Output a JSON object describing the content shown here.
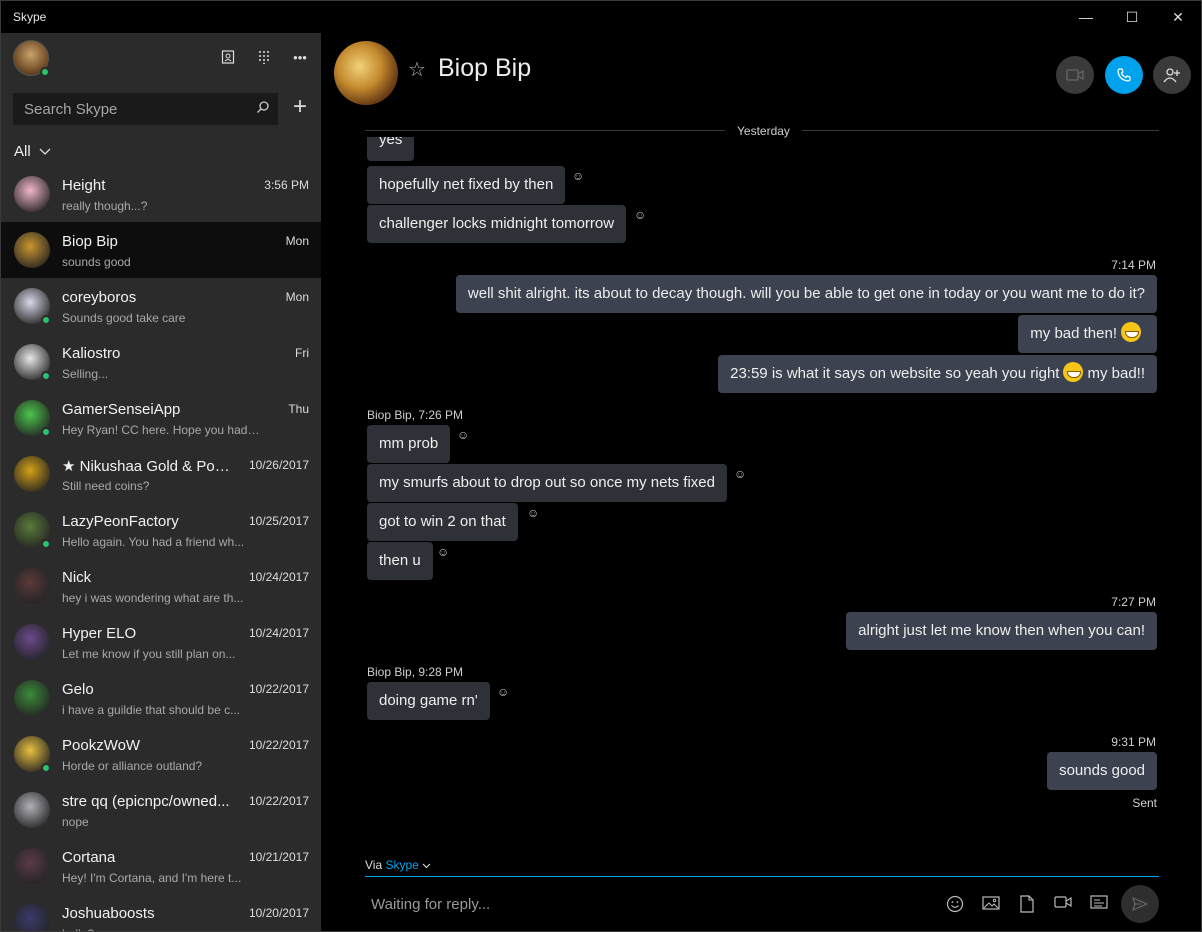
{
  "window": {
    "title": "Skype"
  },
  "sidebar": {
    "search_placeholder": "Search Skype",
    "filter_label": "All",
    "contacts": [
      {
        "name": "Height",
        "preview": "really though...?",
        "time": "3:56 PM",
        "online": false,
        "color": "#f0b6c8"
      },
      {
        "name": "Biop Bip",
        "preview": "sounds good",
        "time": "Mon",
        "online": false,
        "color": "#c9952f"
      },
      {
        "name": "coreyboros",
        "preview": "Sounds good take care",
        "time": "Mon",
        "online": true,
        "color": "#d8d8e8"
      },
      {
        "name": "Kaliostro",
        "preview": "Selling...",
        "time": "Fri",
        "online": true,
        "color": "#e8e8e8"
      },
      {
        "name": "GamerSenseiApp",
        "preview": "Hey Ryan!  CC here. Hope you had a gr...",
        "time": "Thu",
        "online": true,
        "color": "#4cc44c"
      },
      {
        "name": "★ Nikushaa Gold & Pow...",
        "preview": "Still need coins?",
        "time": "10/26/2017",
        "online": false,
        "color": "#d4a017"
      },
      {
        "name": "LazyPeonFactory",
        "preview": "Hello again. You had a friend wh...",
        "time": "10/25/2017",
        "online": true,
        "color": "#5a7a3a"
      },
      {
        "name": "Nick",
        "preview": "hey i was wondering what are th...",
        "time": "10/24/2017",
        "online": false,
        "color": "#5a3a3a"
      },
      {
        "name": "Hyper ELO",
        "preview": "Let me know if you still plan on...",
        "time": "10/24/2017",
        "online": false,
        "color": "#6a4a8a"
      },
      {
        "name": "Gelo",
        "preview": "i have a guildie that should be c...",
        "time": "10/22/2017",
        "online": false,
        "color": "#3a8a3a"
      },
      {
        "name": "PookzWoW",
        "preview": "Horde or alliance outland?",
        "time": "10/22/2017",
        "online": true,
        "color": "#e8c040"
      },
      {
        "name": "stre qq  (epicnpc/owned...",
        "preview": "nope",
        "time": "10/22/2017",
        "online": false,
        "color": "#b0b0b8"
      },
      {
        "name": "Cortana",
        "preview": "Hey! I'm Cortana, and I'm here t...",
        "time": "10/21/2017",
        "online": false,
        "color": "#5a3a4a"
      },
      {
        "name": "Joshuaboosts",
        "preview": "hello?",
        "time": "10/20/2017",
        "online": false,
        "color": "#3a3a6a"
      }
    ]
  },
  "chat": {
    "title": "Biop Bip",
    "date_divider": "Yesterday",
    "via_label": "Via",
    "via_link": "Skype",
    "compose_placeholder": "Waiting for reply...",
    "sent_label": "Sent",
    "meta": {
      "t1": "7:14 PM",
      "t2": "Biop Bip, 7:26 PM",
      "t3": "7:27 PM",
      "t4": "Biop Bip, 9:28 PM",
      "t5": "9:31 PM"
    },
    "messages": {
      "m0": "yes",
      "m1": "hopefully net fixed by then",
      "m2": "challenger locks midnight tomorrow",
      "m3": "well shit alright. its about to decay though. will you be able to get one in today or you want me to do it?",
      "m4": "my bad then!",
      "m5a": "23:59 is what it says on website so yeah you right",
      "m5b": "my bad!!",
      "m6": "mm prob",
      "m7": "my smurfs about to drop out so once my nets fixed",
      "m8": "got to win 2 on that",
      "m9": "then u",
      "m10": "alright just let me know then when you can!",
      "m11": "doing game rn'",
      "m12": "sounds good"
    }
  },
  "colors": {
    "accent": "#00a2ed",
    "online": "#2bc36b",
    "bubble_in": "#2e3137",
    "bubble_out": "#3d4250"
  }
}
